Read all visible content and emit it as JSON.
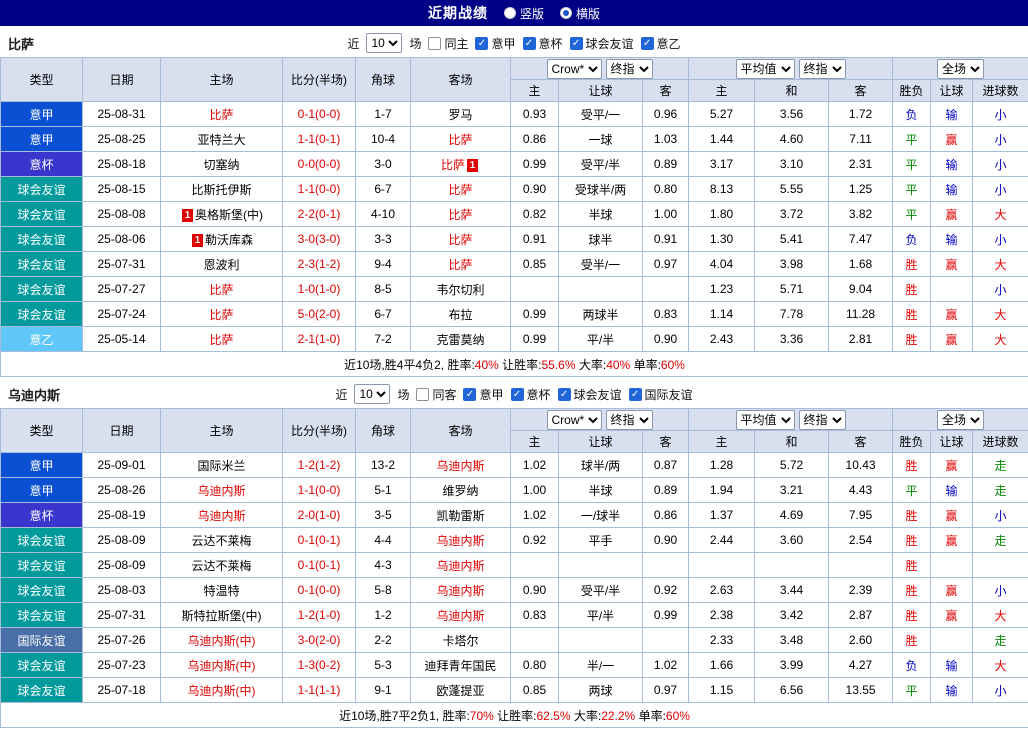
{
  "topbar": {
    "title": "近期战绩",
    "radios": [
      {
        "label": "竖版",
        "selected": false
      },
      {
        "label": "横版",
        "selected": true
      }
    ]
  },
  "table_header": {
    "cols": [
      "类型",
      "日期",
      "主场",
      "比分(半场)",
      "角球",
      "客场"
    ],
    "group1": {
      "select1": "Crow*",
      "select2": "终指",
      "cols": [
        "主",
        "让球",
        "客"
      ]
    },
    "group2": {
      "select1": "平均值",
      "select2": "终指",
      "cols": [
        "主",
        "和",
        "客"
      ]
    },
    "group3": {
      "select1": "全场",
      "cols": [
        "胜负",
        "让球",
        "进球数"
      ]
    }
  },
  "colors": {
    "accent_red": "#e00000",
    "win_red": "#e60000",
    "draw_green": "#008800",
    "lose_blue": "#0000cc",
    "outcome_map": {
      "胜": "win_red",
      "赢": "win_red",
      "大": "win_red",
      "平": "draw_green",
      "走": "draw_green",
      "负": "lose_blue",
      "输": "lose_blue",
      "小": "lose_blue"
    },
    "type_colors": {
      "意甲": "#0b50d2",
      "意杯": "#3a35cc",
      "球会友谊": "#009a9c",
      "意乙": "#5fc8f8",
      "国际友谊": "#4a6fa8"
    }
  },
  "sections": [
    {
      "team": "比萨",
      "filters": {
        "recent_label": "近",
        "count": "10",
        "matches_label": "场",
        "checkboxes": [
          {
            "label": "同主",
            "checked": false
          },
          {
            "label": "意甲",
            "checked": true
          },
          {
            "label": "意杯",
            "checked": true
          },
          {
            "label": "球会友谊",
            "checked": true
          },
          {
            "label": "意乙",
            "checked": true
          }
        ]
      },
      "rows": [
        {
          "type": "意甲",
          "date": "25-08-31",
          "home": {
            "text": "比萨",
            "red": true
          },
          "score": "0-1(0-0)",
          "corner": "1-7",
          "away": {
            "text": "罗马"
          },
          "odds_close": [
            "0.93",
            "受平/一",
            "0.96"
          ],
          "odds_avg": [
            "5.27",
            "3.56",
            "1.72"
          ],
          "outcome": [
            "负",
            "输",
            "小"
          ]
        },
        {
          "type": "意甲",
          "date": "25-08-25",
          "home": {
            "text": "亚特兰大"
          },
          "score": "1-1(0-1)",
          "corner": "10-4",
          "away": {
            "text": "比萨",
            "red": true
          },
          "odds_close": [
            "0.86",
            "一球",
            "1.03"
          ],
          "odds_avg": [
            "1.44",
            "4.60",
            "7.11"
          ],
          "outcome": [
            "平",
            "赢",
            "小"
          ]
        },
        {
          "type": "意杯",
          "date": "25-08-18",
          "home": {
            "text": "切塞纳"
          },
          "score": "0-0(0-0)",
          "corner": "3-0",
          "away": {
            "text": "比萨",
            "red": true,
            "badge_after": "1"
          },
          "odds_close": [
            "0.99",
            "受平/半",
            "0.89"
          ],
          "odds_avg": [
            "3.17",
            "3.10",
            "2.31"
          ],
          "outcome": [
            "平",
            "输",
            "小"
          ]
        },
        {
          "type": "球会友谊",
          "date": "25-08-15",
          "home": {
            "text": "比斯托伊斯"
          },
          "score": "1-1(0-0)",
          "corner": "6-7",
          "away": {
            "text": "比萨",
            "red": true
          },
          "odds_close": [
            "0.90",
            "受球半/两",
            "0.80"
          ],
          "odds_avg": [
            "8.13",
            "5.55",
            "1.25"
          ],
          "outcome": [
            "平",
            "输",
            "小"
          ]
        },
        {
          "type": "球会友谊",
          "date": "25-08-08",
          "home": {
            "text": "奥格斯堡(中)",
            "badge_before": "1"
          },
          "score": "2-2(0-1)",
          "corner": "4-10",
          "away": {
            "text": "比萨",
            "red": true
          },
          "odds_close": [
            "0.82",
            "半球",
            "1.00"
          ],
          "odds_avg": [
            "1.80",
            "3.72",
            "3.82"
          ],
          "outcome": [
            "平",
            "赢",
            "大"
          ]
        },
        {
          "type": "球会友谊",
          "date": "25-08-06",
          "home": {
            "text": "勒沃库森",
            "badge_before": "1"
          },
          "score": "3-0(3-0)",
          "corner": "3-3",
          "away": {
            "text": "比萨",
            "red": true
          },
          "odds_close": [
            "0.91",
            "球半",
            "0.91"
          ],
          "odds_avg": [
            "1.30",
            "5.41",
            "7.47"
          ],
          "outcome": [
            "负",
            "输",
            "小"
          ]
        },
        {
          "type": "球会友谊",
          "date": "25-07-31",
          "home": {
            "text": "恩波利"
          },
          "score": "2-3(1-2)",
          "corner": "9-4",
          "away": {
            "text": "比萨",
            "red": true
          },
          "odds_close": [
            "0.85",
            "受半/一",
            "0.97"
          ],
          "odds_avg": [
            "4.04",
            "3.98",
            "1.68"
          ],
          "outcome": [
            "胜",
            "赢",
            "大"
          ]
        },
        {
          "type": "球会友谊",
          "date": "25-07-27",
          "home": {
            "text": "比萨",
            "red": true
          },
          "score": "1-0(1-0)",
          "corner": "8-5",
          "away": {
            "text": "韦尔切利"
          },
          "odds_close": [
            "",
            "",
            ""
          ],
          "odds_avg": [
            "1.23",
            "5.71",
            "9.04"
          ],
          "outcome": [
            "胜",
            "",
            "小"
          ]
        },
        {
          "type": "球会友谊",
          "date": "25-07-24",
          "home": {
            "text": "比萨",
            "red": true
          },
          "score": "5-0(2-0)",
          "corner": "6-7",
          "away": {
            "text": "布拉"
          },
          "odds_close": [
            "0.99",
            "两球半",
            "0.83"
          ],
          "odds_avg": [
            "1.14",
            "7.78",
            "11.28"
          ],
          "outcome": [
            "胜",
            "赢",
            "大"
          ]
        },
        {
          "type": "意乙",
          "date": "25-05-14",
          "home": {
            "text": "比萨",
            "red": true
          },
          "score": "2-1(1-0)",
          "corner": "7-2",
          "away": {
            "text": "克雷莫纳"
          },
          "odds_close": [
            "0.99",
            "平/半",
            "0.90"
          ],
          "odds_avg": [
            "2.43",
            "3.36",
            "2.81"
          ],
          "outcome": [
            "胜",
            "赢",
            "大"
          ]
        }
      ],
      "summary_parts": [
        {
          "t": "近10场,胜4平4负2, 胜率:"
        },
        {
          "t": "40%",
          "red": true
        },
        {
          "t": " 让胜率:"
        },
        {
          "t": "55.6%",
          "red": true
        },
        {
          "t": " 大率:"
        },
        {
          "t": "40%",
          "red": true
        },
        {
          "t": " 单率:"
        },
        {
          "t": "60%",
          "red": true
        }
      ]
    },
    {
      "team": "乌迪内斯",
      "filters": {
        "recent_label": "近",
        "count": "10",
        "matches_label": "场",
        "checkboxes": [
          {
            "label": "同客",
            "checked": false
          },
          {
            "label": "意甲",
            "checked": true
          },
          {
            "label": "意杯",
            "checked": true
          },
          {
            "label": "球会友谊",
            "checked": true
          },
          {
            "label": "国际友谊",
            "checked": true
          }
        ]
      },
      "rows": [
        {
          "type": "意甲",
          "date": "25-09-01",
          "home": {
            "text": "国际米兰"
          },
          "score": "1-2(1-2)",
          "corner": "13-2",
          "away": {
            "text": "乌迪内斯",
            "red": true
          },
          "odds_close": [
            "1.02",
            "球半/两",
            "0.87"
          ],
          "odds_avg": [
            "1.28",
            "5.72",
            "10.43"
          ],
          "outcome": [
            "胜",
            "赢",
            "走"
          ]
        },
        {
          "type": "意甲",
          "date": "25-08-26",
          "home": {
            "text": "乌迪内斯",
            "red": true
          },
          "score": "1-1(0-0)",
          "corner": "5-1",
          "away": {
            "text": "维罗纳"
          },
          "odds_close": [
            "1.00",
            "半球",
            "0.89"
          ],
          "odds_avg": [
            "1.94",
            "3.21",
            "4.43"
          ],
          "outcome": [
            "平",
            "输",
            "走"
          ]
        },
        {
          "type": "意杯",
          "date": "25-08-19",
          "home": {
            "text": "乌迪内斯",
            "red": true
          },
          "score": "2-0(1-0)",
          "corner": "3-5",
          "away": {
            "text": "凯勒雷斯"
          },
          "odds_close": [
            "1.02",
            "一/球半",
            "0.86"
          ],
          "odds_avg": [
            "1.37",
            "4.69",
            "7.95"
          ],
          "outcome": [
            "胜",
            "赢",
            "小"
          ]
        },
        {
          "type": "球会友谊",
          "date": "25-08-09",
          "home": {
            "text": "云达不莱梅"
          },
          "score": "0-1(0-1)",
          "corner": "4-4",
          "away": {
            "text": "乌迪内斯",
            "red": true
          },
          "odds_close": [
            "0.92",
            "平手",
            "0.90"
          ],
          "odds_avg": [
            "2.44",
            "3.60",
            "2.54"
          ],
          "outcome": [
            "胜",
            "赢",
            "走"
          ]
        },
        {
          "type": "球会友谊",
          "date": "25-08-09",
          "home": {
            "text": "云达不莱梅"
          },
          "score": "0-1(0-1)",
          "corner": "4-3",
          "away": {
            "text": "乌迪内斯",
            "red": true
          },
          "odds_close": [
            "",
            "",
            ""
          ],
          "odds_avg": [
            "",
            "",
            ""
          ],
          "outcome": [
            "胜",
            "",
            ""
          ]
        },
        {
          "type": "球会友谊",
          "date": "25-08-03",
          "home": {
            "text": "特温特"
          },
          "score": "0-1(0-0)",
          "corner": "5-8",
          "away": {
            "text": "乌迪内斯",
            "red": true
          },
          "odds_close": [
            "0.90",
            "受平/半",
            "0.92"
          ],
          "odds_avg": [
            "2.63",
            "3.44",
            "2.39"
          ],
          "outcome": [
            "胜",
            "赢",
            "小"
          ]
        },
        {
          "type": "球会友谊",
          "date": "25-07-31",
          "home": {
            "text": "斯特拉斯堡(中)"
          },
          "score": "1-2(1-0)",
          "corner": "1-2",
          "away": {
            "text": "乌迪内斯",
            "red": true
          },
          "odds_close": [
            "0.83",
            "平/半",
            "0.99"
          ],
          "odds_avg": [
            "2.38",
            "3.42",
            "2.87"
          ],
          "outcome": [
            "胜",
            "赢",
            "大"
          ]
        },
        {
          "type": "国际友谊",
          "date": "25-07-26",
          "home": {
            "text": "乌迪内斯(中)",
            "red": true
          },
          "score": "3-0(2-0)",
          "corner": "2-2",
          "away": {
            "text": "卡塔尔"
          },
          "odds_close": [
            "",
            "",
            ""
          ],
          "odds_avg": [
            "2.33",
            "3.48",
            "2.60"
          ],
          "outcome": [
            "胜",
            "",
            "走"
          ]
        },
        {
          "type": "球会友谊",
          "date": "25-07-23",
          "home": {
            "text": "乌迪内斯(中)",
            "red": true
          },
          "score": "1-3(0-2)",
          "corner": "5-3",
          "away": {
            "text": "迪拜青年国民"
          },
          "odds_close": [
            "0.80",
            "半/一",
            "1.02"
          ],
          "odds_avg": [
            "1.66",
            "3.99",
            "4.27"
          ],
          "outcome": [
            "负",
            "输",
            "大"
          ]
        },
        {
          "type": "球会友谊",
          "date": "25-07-18",
          "home": {
            "text": "乌迪内斯(中)",
            "red": true
          },
          "score": "1-1(1-1)",
          "corner": "9-1",
          "away": {
            "text": "欧蓬提亚"
          },
          "odds_close": [
            "0.85",
            "两球",
            "0.97"
          ],
          "odds_avg": [
            "1.15",
            "6.56",
            "13.55"
          ],
          "outcome": [
            "平",
            "输",
            "小"
          ]
        }
      ],
      "summary_parts": [
        {
          "t": "近10场,胜7平2负1, 胜率:"
        },
        {
          "t": "70%",
          "red": true
        },
        {
          "t": " 让胜率:"
        },
        {
          "t": "62.5%",
          "red": true
        },
        {
          "t": " 大率:"
        },
        {
          "t": "22.2%",
          "red": true
        },
        {
          "t": " 单率:"
        },
        {
          "t": "60%",
          "red": true
        }
      ]
    }
  ]
}
